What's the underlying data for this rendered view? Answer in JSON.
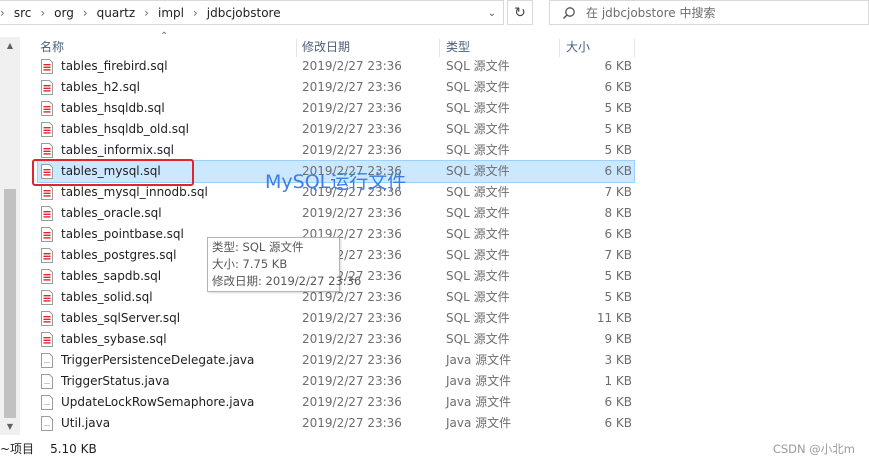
{
  "address": {
    "breadcrumbs": [
      "src",
      "org",
      "quartz",
      "impl",
      "jdbcjobstore"
    ]
  },
  "search": {
    "placeholder": "在 jdbcjobstore 中搜索"
  },
  "columns": {
    "name": "名称",
    "date": "修改日期",
    "type": "类型",
    "size": "大小"
  },
  "files": [
    {
      "name": "tables_firebird.sql",
      "date": "2019/2/27 23:36",
      "type": "SQL 源文件",
      "size": "6 KB",
      "icon": "sql-file-icon"
    },
    {
      "name": "tables_h2.sql",
      "date": "2019/2/27 23:36",
      "type": "SQL 源文件",
      "size": "6 KB",
      "icon": "sql-file-icon"
    },
    {
      "name": "tables_hsqldb.sql",
      "date": "2019/2/27 23:36",
      "type": "SQL 源文件",
      "size": "5 KB",
      "icon": "sql-file-icon"
    },
    {
      "name": "tables_hsqldb_old.sql",
      "date": "2019/2/27 23:36",
      "type": "SQL 源文件",
      "size": "5 KB",
      "icon": "sql-file-icon"
    },
    {
      "name": "tables_informix.sql",
      "date": "2019/2/27 23:36",
      "type": "SQL 源文件",
      "size": "5 KB",
      "icon": "sql-file-icon"
    },
    {
      "name": "tables_mysql.sql",
      "date": "2019/2/27 23:36",
      "type": "SQL 源文件",
      "size": "6 KB",
      "icon": "sql-file-icon",
      "selected": true
    },
    {
      "name": "tables_mysql_innodb.sql",
      "date": "2019/2/27 23:36",
      "type": "SQL 源文件",
      "size": "7 KB",
      "icon": "sql-file-icon"
    },
    {
      "name": "tables_oracle.sql",
      "date": "2019/2/27 23:36",
      "type": "SQL 源文件",
      "size": "8 KB",
      "icon": "sql-file-icon"
    },
    {
      "name": "tables_pointbase.sql",
      "date": "2019/2/27 23:36",
      "type": "SQL 源文件",
      "size": "6 KB",
      "icon": "sql-file-icon"
    },
    {
      "name": "tables_postgres.sql",
      "date": "2019/2/27 23:36",
      "type": "SQL 源文件",
      "size": "7 KB",
      "icon": "sql-file-icon"
    },
    {
      "name": "tables_sapdb.sql",
      "date": "2019/2/27 23:36",
      "type": "SQL 源文件",
      "size": "5 KB",
      "icon": "sql-file-icon"
    },
    {
      "name": "tables_solid.sql",
      "date": "2019/2/27 23:36",
      "type": "SQL 源文件",
      "size": "5 KB",
      "icon": "sql-file-icon"
    },
    {
      "name": "tables_sqlServer.sql",
      "date": "2019/2/27 23:36",
      "type": "SQL 源文件",
      "size": "11 KB",
      "icon": "sql-file-icon"
    },
    {
      "name": "tables_sybase.sql",
      "date": "2019/2/27 23:36",
      "type": "SQL 源文件",
      "size": "9 KB",
      "icon": "sql-file-icon"
    },
    {
      "name": "TriggerPersistenceDelegate.java",
      "date": "2019/2/27 23:36",
      "type": "Java 源文件",
      "size": "3 KB",
      "icon": "java-file-icon"
    },
    {
      "name": "TriggerStatus.java",
      "date": "2019/2/27 23:36",
      "type": "Java 源文件",
      "size": "1 KB",
      "icon": "java-file-icon"
    },
    {
      "name": "UpdateLockRowSemaphore.java",
      "date": "2019/2/27 23:36",
      "type": "Java 源文件",
      "size": "6 KB",
      "icon": "java-file-icon"
    },
    {
      "name": "Util.java",
      "date": "2019/2/27 23:36",
      "type": "Java 源文件",
      "size": "6 KB",
      "icon": "java-file-icon"
    }
  ],
  "annotation": {
    "text": "MySQL运行文件",
    "color": "#3d7ee6"
  },
  "tooltip": {
    "type": "类型: SQL 源文件",
    "size": "大小: 7.75 KB",
    "date": "修改日期: 2019/2/27 23:36"
  },
  "status": {
    "items": "~项目",
    "size": "5.10 KB"
  },
  "watermark": "CSDN @小北m",
  "colors": {
    "selection": "#cce8ff",
    "highlight": "#e0262a",
    "sql_icon": "#e0262a"
  }
}
